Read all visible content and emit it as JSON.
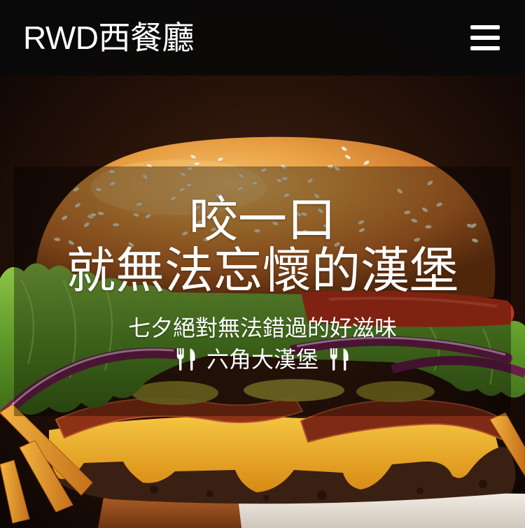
{
  "header": {
    "title": "RWD西餐廳",
    "menu_icon": "hamburger-menu-icon"
  },
  "hero": {
    "headline": [
      "咬一口",
      "就無法忘懷的漢堡"
    ],
    "subtitle": "七夕絕對無法錯過的好滋味",
    "product": {
      "name": "六角大漢堡",
      "icon_left": "cutlery-icon",
      "icon_right": "cutlery-icon"
    }
  },
  "colors": {
    "header_bg": "#0a0a0a",
    "text": "#ffffff"
  }
}
